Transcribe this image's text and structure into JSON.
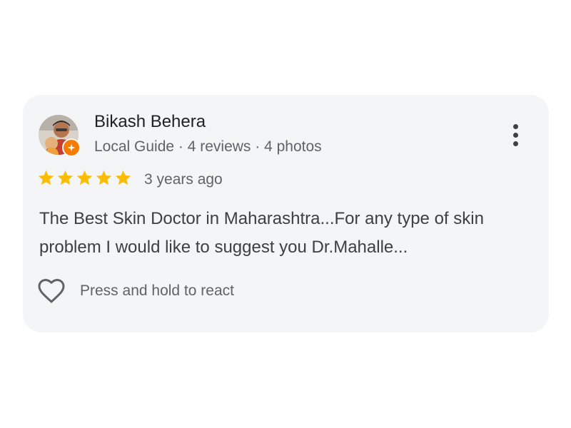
{
  "review": {
    "reviewer_name": "Bikash Behera",
    "reviewer_meta": "Local Guide · 4 reviews · 4 photos",
    "rating": 5,
    "rating_max": 5,
    "time_ago": "3 years ago",
    "text": "The Best Skin Doctor in Maharashtra...For any type of skin problem I would like to suggest you Dr.Mahalle...",
    "react_label": "Press and hold to react"
  },
  "colors": {
    "card_bg": "#f4f5f7",
    "star": "#fbbc04",
    "guide_badge": "#f57c00",
    "text_primary": "#202124",
    "text_secondary": "#5f6368"
  },
  "icons": {
    "more": "more-vert-icon",
    "react": "heart-outline-icon",
    "badge": "local-guide-badge-icon"
  }
}
